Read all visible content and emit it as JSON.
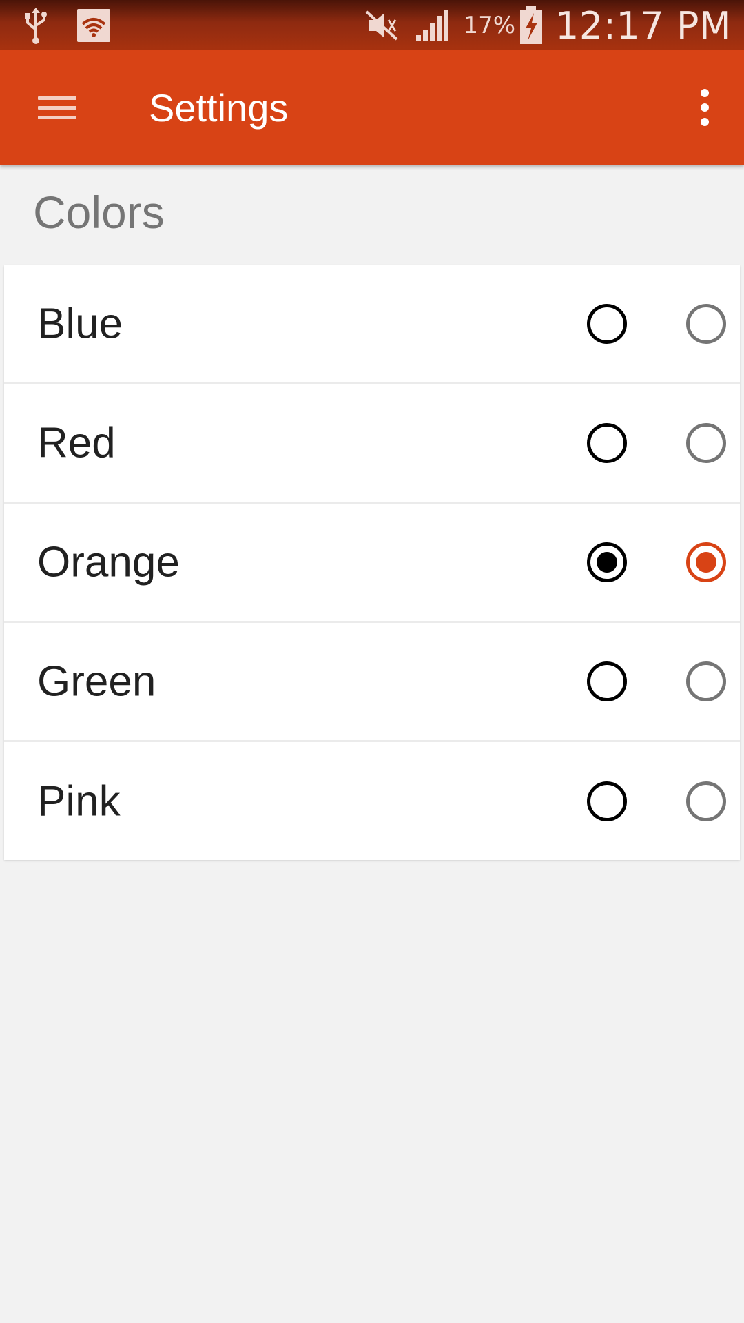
{
  "status_bar": {
    "left_icons": [
      "usb-icon",
      "wifi-icon"
    ],
    "right_icons": [
      "mute-icon",
      "signal-icon",
      "battery-charging-icon"
    ],
    "battery": "17%",
    "time": "12:17 PM"
  },
  "app_bar": {
    "title": "Settings",
    "menu_icon": "hamburger-menu-icon",
    "overflow_icon": "more-vert-icon"
  },
  "section": {
    "title": "Colors"
  },
  "colors": {
    "accent": "#d84315",
    "status_bar": "#a8320f",
    "background": "#f2f2f2"
  },
  "options": [
    {
      "label": "Blue",
      "checked": false
    },
    {
      "label": "Red",
      "checked": false
    },
    {
      "label": "Orange",
      "checked": true
    },
    {
      "label": "Green",
      "checked": false
    },
    {
      "label": "Pink",
      "checked": false
    }
  ]
}
